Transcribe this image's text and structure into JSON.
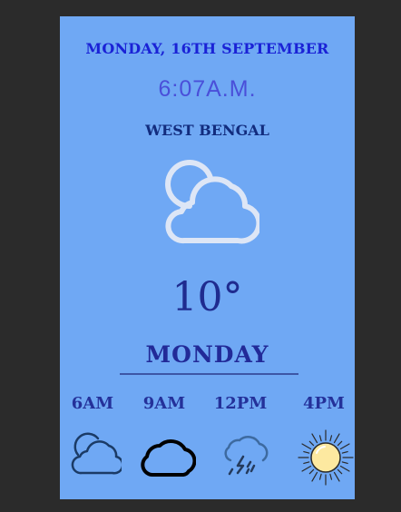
{
  "header": {
    "date": "MONDAY, 16TH SEPTEMBER",
    "time": "6:07A.M.",
    "location": "WEST BENGAL"
  },
  "current": {
    "icon": "partly-cloudy-icon",
    "temperature": "10°",
    "day": "MONDAY"
  },
  "hourly": [
    {
      "label": "6AM",
      "icon": "cloudy-icon"
    },
    {
      "label": "9AM",
      "icon": "cloud-icon"
    },
    {
      "label": "12PM",
      "icon": "thunderstorm-icon"
    },
    {
      "label": "4PM",
      "icon": "sun-icon"
    }
  ],
  "colors": {
    "background": "#6fa8f4",
    "frame": "#2b2b2b",
    "date_text": "#1a22d6",
    "time_text": "#4a4fd9",
    "sun_fill": "#fde9a0"
  }
}
